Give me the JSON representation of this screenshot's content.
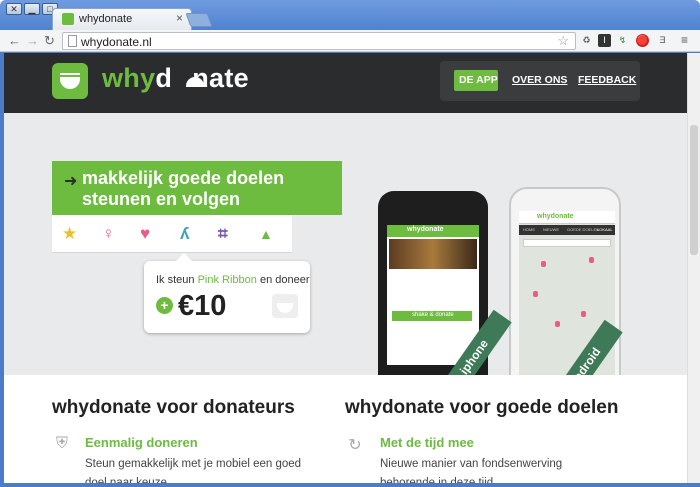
{
  "browser": {
    "tab_title": "whydonate",
    "tab_close": "×",
    "url": "whydonate.nl",
    "window_buttons": [
      "▁",
      "□",
      "✕"
    ],
    "nav_icons": {
      "back": "←",
      "forward": "→",
      "reload": "↻"
    },
    "extension_icons": [
      "☆",
      "♻",
      "I",
      "↯",
      "🛑",
      "Ǝ",
      "≡"
    ]
  },
  "site": {
    "logo": {
      "why": "why",
      "rest": "d",
      "tail": "nate"
    },
    "nav": [
      {
        "label": "DE APP",
        "active": true
      },
      {
        "label": "OVER ONS",
        "active": false
      },
      {
        "label": "FEEDBACK",
        "active": false
      }
    ],
    "brand_color": "#6dbb3f",
    "header_color": "#2b2c2e"
  },
  "hero": {
    "banner_line1": "makkelijk goede doelen",
    "banner_line2": "steunen en volgen",
    "icons": [
      {
        "name": "star-icon",
        "glyph": "★",
        "color": "#e6c22e"
      },
      {
        "name": "person-icon",
        "glyph": "♀",
        "color": "#e06a9a"
      },
      {
        "name": "heart-icon",
        "glyph": "♥",
        "color": "#e85b8c"
      },
      {
        "name": "giraffe-icon",
        "glyph": "ʎ",
        "color": "#3aa3b8"
      },
      {
        "name": "frame-icon",
        "glyph": "⌗",
        "color": "#7a5aa8"
      },
      {
        "name": "tree-icon",
        "glyph": "▲",
        "color": "#6dbb3f"
      }
    ],
    "bubble": {
      "prefix": "Ik steun ",
      "charity": "Pink Ribbon",
      "suffix": " en doneer",
      "amount": "€10",
      "plus": "+"
    },
    "iphone_label": "iphone",
    "android_label": "android",
    "iphone_screen": {
      "title": "whydonate",
      "button": "shake & donate"
    },
    "android_screen": {
      "title": "whydonate",
      "tabs": [
        "HOME",
        "NIEUWE",
        "GOEDE DOELEN",
        "LOKAAL"
      ],
      "search": "Zoek goede doelen"
    }
  },
  "lower": {
    "left": {
      "title": "whydonate voor donateurs",
      "feature_title": "Eenmalig doneren",
      "feature_text": "Steun gemakkelijk met je mobiel een goed doel naar keuze."
    },
    "right": {
      "title": "whydonate voor goede doelen",
      "feature_title": "Met de tijd mee",
      "feature_text": "Nieuwe manier van fondsenwerving behorende in deze tijd."
    }
  }
}
